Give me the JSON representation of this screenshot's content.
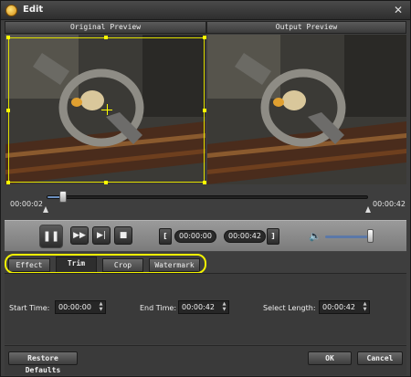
{
  "window": {
    "title": "Edit",
    "close_glyph": "✕"
  },
  "previews": {
    "original_label": "Original Preview",
    "output_label": "Output Preview"
  },
  "seek": {
    "current_time": "00:00:02",
    "end_time": "00:00:42",
    "position_fraction": 0.05
  },
  "playback": {
    "pause_icon": "❚❚",
    "next_frame_icon": "▶▶",
    "step_icon": "▶|",
    "stop_icon": "■",
    "trim_start_bracket": "[",
    "trim_start_time": "00:00:00",
    "trim_end_time": "00:00:42",
    "trim_end_bracket": "]",
    "volume_icon": "🔈",
    "volume_fraction": 0.95
  },
  "tabs": [
    {
      "label": "Effect"
    },
    {
      "label": "Trim"
    },
    {
      "label": "Crop"
    },
    {
      "label": "Watermark"
    }
  ],
  "active_tab": "Trim",
  "trim": {
    "start_label": "Start Time:",
    "start_value": "00:00:00",
    "end_label": "End Time:",
    "end_value": "00:00:42",
    "length_label": "Select Length:",
    "length_value": "00:00:42"
  },
  "buttons": {
    "restore": "Restore Defaults",
    "ok": "OK",
    "cancel": "Cancel"
  },
  "colors": {
    "crop_frame": "#e0e000",
    "highlight": "#f2f200",
    "seek_fill": "#6b8fbf"
  }
}
